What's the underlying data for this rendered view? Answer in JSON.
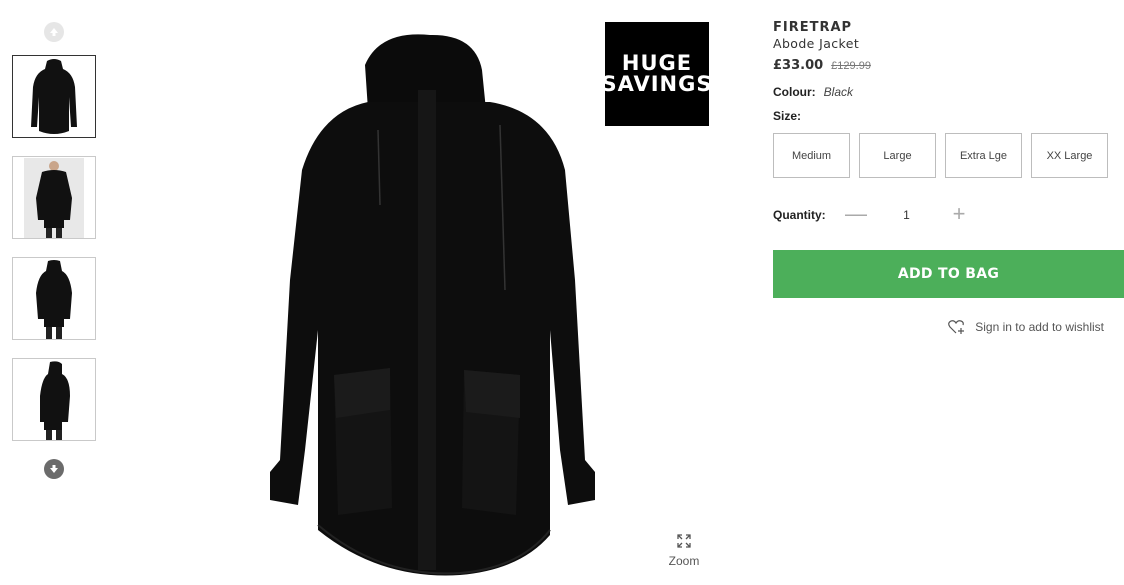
{
  "thumbnails": {
    "up_icon": "arrow-up-icon",
    "down_icon": "arrow-down-icon",
    "items": [
      "jacket-front",
      "model-front",
      "model-back",
      "model-side"
    ]
  },
  "badge": {
    "line1": "HUGE",
    "line2": "SAVINGS"
  },
  "zoom": {
    "label": "Zoom",
    "icon": "expand-icon"
  },
  "product": {
    "brand": "FIRETRAP",
    "name": "Abode Jacket",
    "price": "£33.00",
    "was_price": "£129.99",
    "colour_label": "Colour:",
    "colour_value": "Black",
    "size_label": "Size:",
    "sizes": [
      "Medium",
      "Large",
      "Extra Lge",
      "XX Large"
    ],
    "quantity_label": "Quantity:",
    "quantity": "1",
    "add_to_bag": "ADD TO BAG",
    "wishlist": "Sign in to add to wishlist"
  },
  "colors": {
    "accent_green": "#4caf5a",
    "badge_bg": "#000000"
  }
}
